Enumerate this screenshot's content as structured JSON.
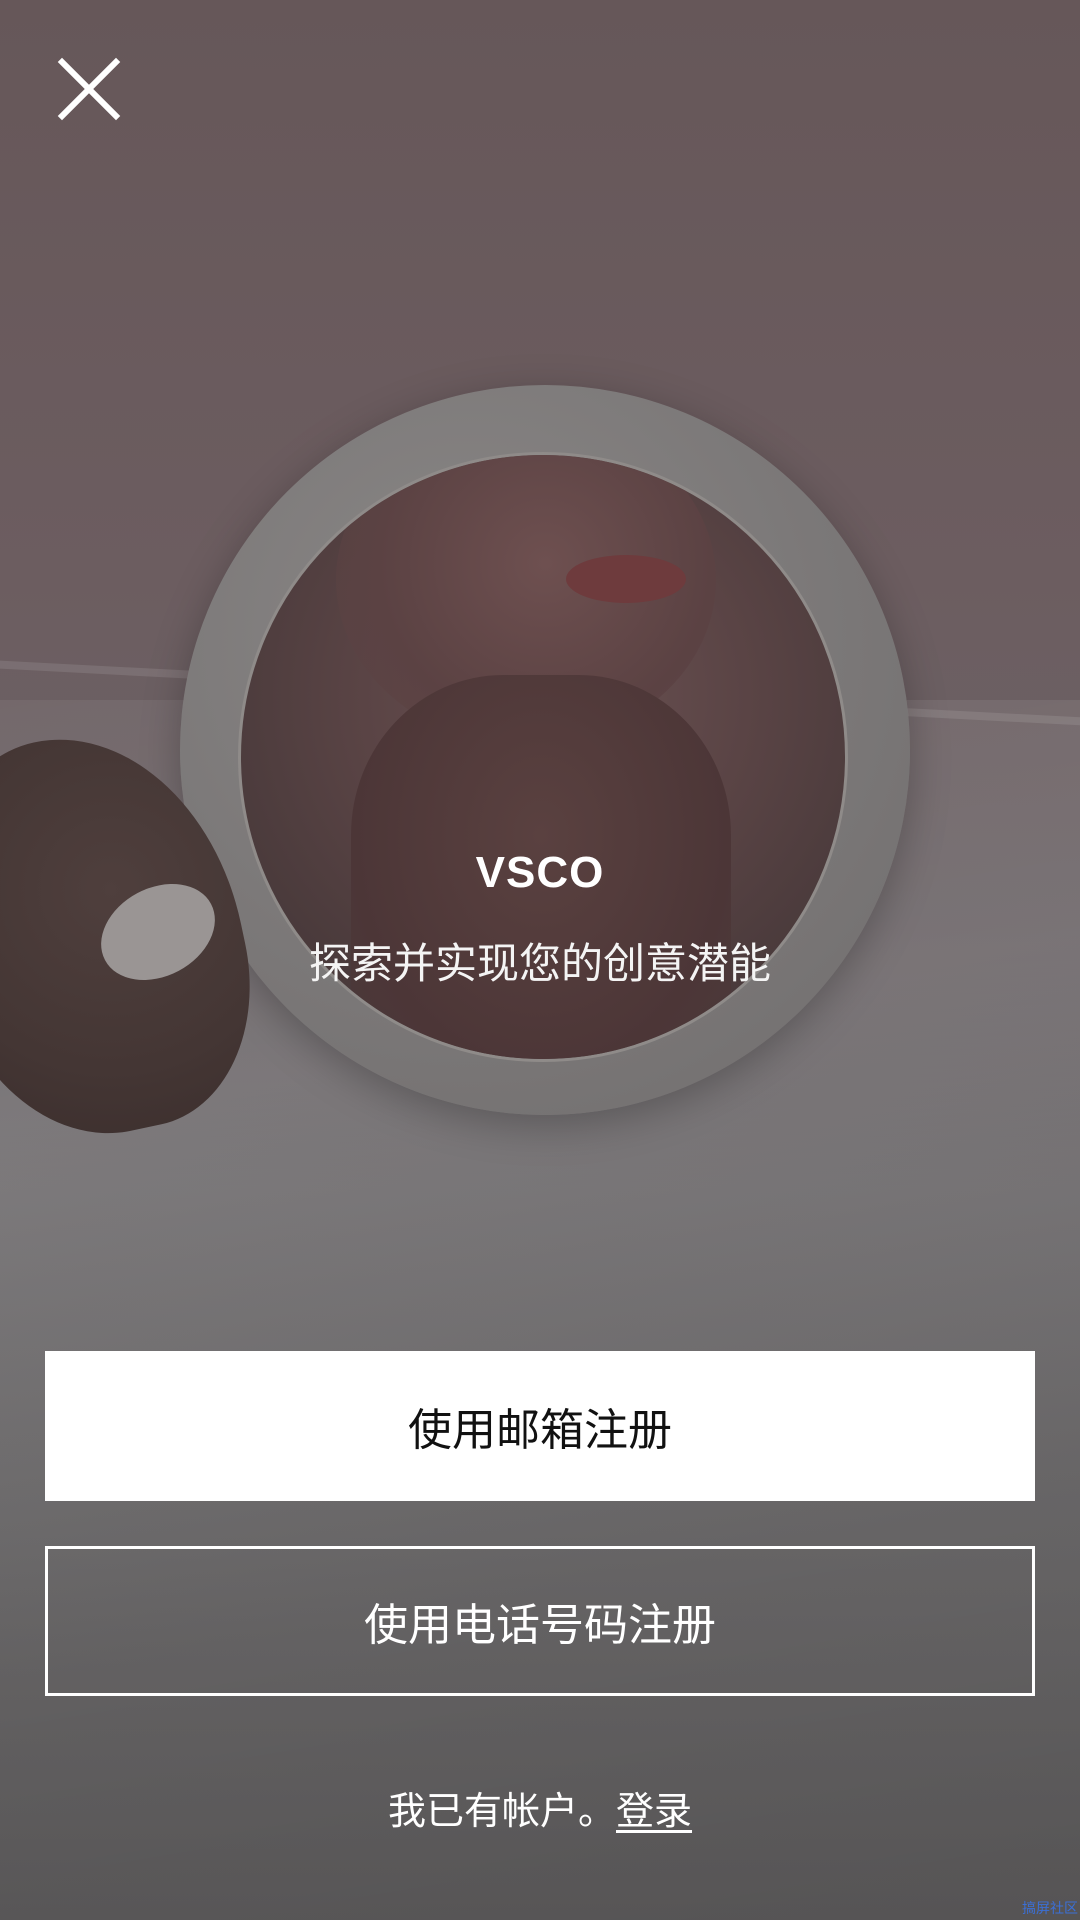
{
  "header": {
    "close_icon": "close-icon"
  },
  "hero": {
    "brand": "VSCO",
    "tagline": "探索并实现您的创意潜能"
  },
  "actions": {
    "email_signup_label": "使用邮箱注册",
    "phone_signup_label": "使用电话号码注册"
  },
  "footer": {
    "existing_account_text": "我已有帐户。",
    "login_label": "登录"
  },
  "watermark": "搞屏社区",
  "colors": {
    "primary_button_bg": "#ffffff",
    "primary_button_text": "#111111",
    "outline_button_border": "#ffffff",
    "text_light": "#ffffff"
  }
}
